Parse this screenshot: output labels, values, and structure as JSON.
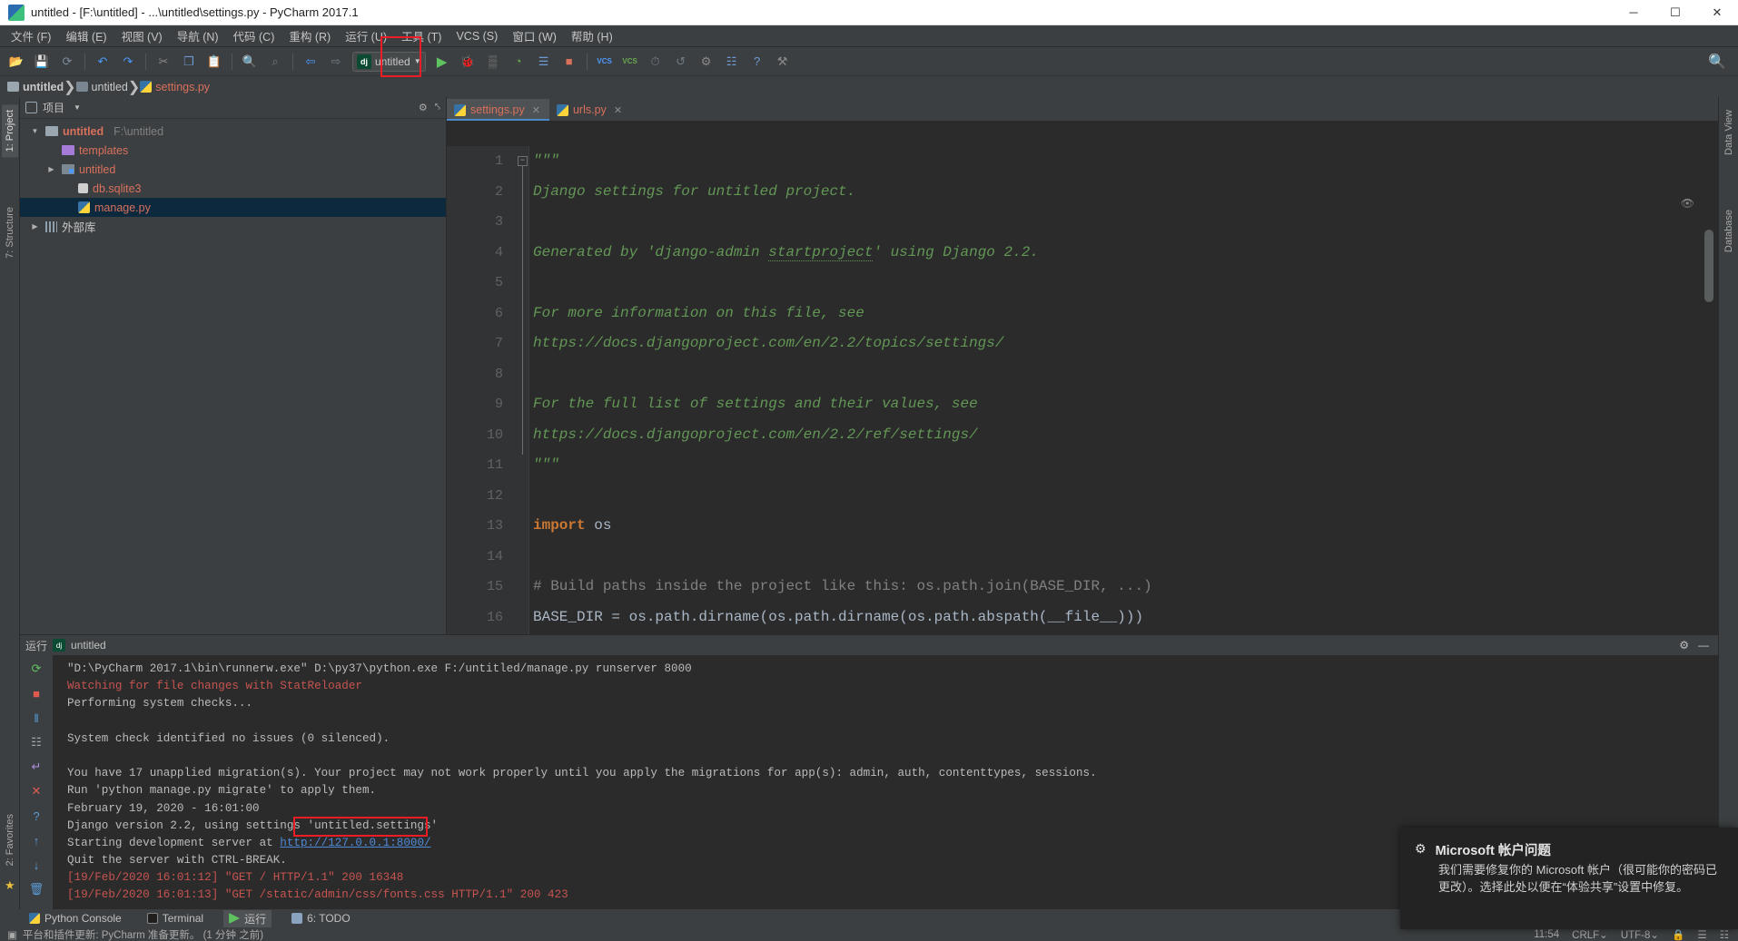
{
  "window": {
    "title": "untitled - [F:\\untitled] - ...\\untitled\\settings.py - PyCharm 2017.1",
    "app_icon": "pycharm-icon",
    "minimize": "─",
    "maximize": "☐",
    "close": "✕"
  },
  "menubar": {
    "items": [
      {
        "label": "文件 (F)"
      },
      {
        "label": "编辑 (E)"
      },
      {
        "label": "视图 (V)"
      },
      {
        "label": "导航 (N)"
      },
      {
        "label": "代码 (C)"
      },
      {
        "label": "重构 (R)"
      },
      {
        "label": "运行 (U)"
      },
      {
        "label": "工具 (T)"
      },
      {
        "label": "VCS (S)"
      },
      {
        "label": "窗口 (W)"
      },
      {
        "label": "帮助 (H)"
      }
    ]
  },
  "toolbar": {
    "buttons": [
      {
        "name": "open-folder-icon",
        "glyph": "📂",
        "color": "#d9a441"
      },
      {
        "name": "save-all-icon",
        "glyph": "💾",
        "color": "#9aa7b0"
      },
      {
        "name": "sync-icon",
        "glyph": "⟳",
        "color": "#7b8b99"
      },
      {
        "name": "undo-icon",
        "glyph": "↶",
        "color": "#4c9aff"
      },
      {
        "name": "redo-icon",
        "glyph": "↷",
        "color": "#4c9aff"
      },
      {
        "name": "cut-icon",
        "glyph": "✂",
        "color": "#8c8c8c"
      },
      {
        "name": "copy-icon",
        "glyph": "❐",
        "color": "#6e9ad4"
      },
      {
        "name": "paste-icon",
        "glyph": "📋",
        "color": "#7b8b99"
      },
      {
        "name": "find-icon",
        "glyph": "🔍",
        "color": "#8ab0d8"
      },
      {
        "name": "replace-icon",
        "glyph": "⌕",
        "color": "#6f7c86"
      },
      {
        "name": "back-icon",
        "glyph": "⇦",
        "color": "#4c9aff"
      },
      {
        "name": "forward-icon",
        "glyph": "⇨",
        "color": "#6f7c86"
      }
    ],
    "run_config": {
      "badge": "dj",
      "name": "untitled",
      "caret": "▼"
    },
    "run_button": {
      "name": "run-button",
      "glyph": "▶",
      "color": "#5ec25e"
    },
    "debug_button": {
      "name": "debug-button",
      "glyph": "🐞",
      "color": "#5ec25e"
    },
    "right_buttons": [
      {
        "name": "coverage-icon",
        "glyph": "▒",
        "color": "#8a8a8a"
      },
      {
        "name": "profile-icon",
        "glyph": "◔",
        "color": "#6aa84f"
      },
      {
        "name": "attach-icon",
        "glyph": "☰",
        "color": "#6e9ad4"
      },
      {
        "name": "stop-icon",
        "glyph": "■",
        "color": "#d9705c"
      },
      {
        "name": "vcs-update-icon",
        "glyph": "VCS",
        "color": "#4c9aff"
      },
      {
        "name": "vcs-commit-icon",
        "glyph": "VCS",
        "color": "#6aa84f"
      },
      {
        "name": "history-icon",
        "glyph": "⏱",
        "color": "#6f7c86"
      },
      {
        "name": "revert-icon",
        "glyph": "↺",
        "color": "#6f7c86"
      },
      {
        "name": "settings-icon",
        "glyph": "⚙",
        "color": "#8a8a8a"
      },
      {
        "name": "structure-icon",
        "glyph": "☷",
        "color": "#6e9ad4"
      },
      {
        "name": "help-icon",
        "glyph": "?",
        "color": "#6e9ad4"
      },
      {
        "name": "external-tool-icon",
        "glyph": "⚒",
        "color": "#8a8a8a"
      }
    ],
    "search_icon": "🔍"
  },
  "breadcrumb": {
    "items": [
      {
        "label": "untitled",
        "icon": "folder-icon",
        "bold": true
      },
      {
        "label": "untitled",
        "icon": "source-folder-icon",
        "bold": false
      },
      {
        "label": "settings.py",
        "icon": "python-file-icon",
        "bold": false
      }
    ],
    "separator": "❯"
  },
  "left_tool_strip": {
    "project_tab": "1: Project",
    "structure_tab": "7: Structure",
    "favorites_tab": "2: Favorites",
    "star_icon": "★"
  },
  "right_tool_strip": {
    "data_view_tab": "Data View",
    "database_tab": "Database"
  },
  "project_panel": {
    "title": "项目",
    "caret": "▼",
    "settings_icon": "⚙",
    "collapse_icon": "⤣",
    "tree": [
      {
        "indent": 0,
        "twisty": "▼",
        "icon": "folder-icon",
        "label": "untitled",
        "path": "F:\\untitled",
        "bold": true,
        "selected": false
      },
      {
        "indent": 1,
        "twisty": "",
        "icon": "templates-folder-icon",
        "label": "templates",
        "path": "",
        "bold": false,
        "selected": false
      },
      {
        "indent": 1,
        "twisty": "▶",
        "icon": "source-folder-icon",
        "label": "untitled",
        "path": "",
        "bold": false,
        "selected": false
      },
      {
        "indent": 2,
        "twisty": "",
        "icon": "sqlite-file-icon",
        "label": "db.sqlite3",
        "path": "",
        "bold": false,
        "selected": false
      },
      {
        "indent": 2,
        "twisty": "",
        "icon": "python-file-icon",
        "label": "manage.py",
        "path": "",
        "bold": false,
        "selected": true
      },
      {
        "indent": 0,
        "twisty": "▶",
        "icon": "external-libraries-icon",
        "label": "外部库",
        "path": "",
        "bold": false,
        "selected": false
      }
    ]
  },
  "editor": {
    "tabs": [
      {
        "label": "settings.py",
        "active": true,
        "close": "✕"
      },
      {
        "label": "urls.py",
        "active": false,
        "close": "✕"
      }
    ],
    "eye_icon": "👁",
    "lines": [
      {
        "n": "1",
        "text": "\"\"\"",
        "style": "doc"
      },
      {
        "n": "2",
        "text": "Django settings for untitled project.",
        "style": "doc"
      },
      {
        "n": "3",
        "text": "",
        "style": "doc"
      },
      {
        "n": "4",
        "text": "Generated by 'django-admin startproject' using Django 2.2.",
        "style": "doc-underline"
      },
      {
        "n": "5",
        "text": "",
        "style": "doc"
      },
      {
        "n": "6",
        "text": "For more information on this file, see",
        "style": "doc"
      },
      {
        "n": "7",
        "text": "https://docs.djangoproject.com/en/2.2/topics/settings/",
        "style": "doc"
      },
      {
        "n": "8",
        "text": "",
        "style": "doc"
      },
      {
        "n": "9",
        "text": "For the full list of settings and their values, see",
        "style": "doc"
      },
      {
        "n": "10",
        "text": "https://docs.djangoproject.com/en/2.2/ref/settings/",
        "style": "doc"
      },
      {
        "n": "11",
        "text": "\"\"\"",
        "style": "doc"
      },
      {
        "n": "12",
        "text": "",
        "style": "plain"
      },
      {
        "n": "13",
        "text": "import os",
        "style": "import"
      },
      {
        "n": "14",
        "text": "",
        "style": "plain"
      },
      {
        "n": "15",
        "text": "# Build paths inside the project like this: os.path.join(BASE_DIR, ...)",
        "style": "comment"
      },
      {
        "n": "16",
        "text": "BASE_DIR = os.path.dirname(os.path.dirname(os.path.abspath(__file__)))",
        "style": "plain"
      }
    ]
  },
  "run_panel": {
    "header_label": "运行",
    "config_badge": "dj",
    "config_name": "untitled",
    "settings_icon": "⚙",
    "minimize_icon": "—",
    "sidebar_icons": [
      {
        "name": "rerun-icon",
        "glyph": "⟳",
        "color": "#5ec25e"
      },
      {
        "name": "stop-icon",
        "glyph": "■",
        "color": "#e05a4f"
      },
      {
        "name": "pause-icon",
        "glyph": "‖",
        "color": "#5b9bd5"
      },
      {
        "name": "print-icon",
        "glyph": "☷",
        "color": "#9aa7b0"
      },
      {
        "name": "soft-wrap-icon",
        "glyph": "↵",
        "color": "#a98bd8"
      },
      {
        "name": "clear-icon",
        "glyph": "✕",
        "color": "#e05a4f"
      },
      {
        "name": "help-icon",
        "glyph": "?",
        "color": "#5b9bd5"
      },
      {
        "name": "scroll-up-icon",
        "glyph": "↑",
        "color": "#5b9bd5"
      },
      {
        "name": "scroll-down-icon",
        "glyph": "↓",
        "color": "#5b9bd5"
      },
      {
        "name": "trash-icon",
        "glyph": "🗑",
        "color": "#5b9bd5"
      }
    ],
    "console_lines": [
      {
        "text": "\"D:\\PyCharm 2017.1\\bin\\runnerw.exe\" D:\\py37\\python.exe F:/untitled/manage.py runserver 8000",
        "style": "normal"
      },
      {
        "text": "Watching for file changes with StatReloader",
        "style": "error"
      },
      {
        "text": "Performing system checks...",
        "style": "normal"
      },
      {
        "text": "",
        "style": "normal"
      },
      {
        "text": "System check identified no issues (0 silenced).",
        "style": "normal"
      },
      {
        "text": "",
        "style": "normal"
      },
      {
        "text": "You have 17 unapplied migration(s). Your project may not work properly until you apply the migrations for app(s): admin, auth, contenttypes, sessions.",
        "style": "normal"
      },
      {
        "text": "Run 'python manage.py migrate' to apply them.",
        "style": "normal"
      },
      {
        "text": "February 19, 2020 - 16:01:00",
        "style": "normal"
      },
      {
        "text": "Django version 2.2, using settings 'untitled.settings'",
        "style": "normal"
      },
      {
        "text": "Starting development server at ",
        "style": "link-prefix",
        "link": "http://127.0.0.1:8000/"
      },
      {
        "text": "Quit the server with CTRL-BREAK.",
        "style": "normal"
      },
      {
        "text": "[19/Feb/2020 16:01:12] \"GET / HTTP/1.1\" 200 16348",
        "style": "error"
      },
      {
        "text": "[19/Feb/2020 16:01:13] \"GET /static/admin/css/fonts.css HTTP/1.1\" 200 423",
        "style": "error"
      }
    ]
  },
  "bottom_tabs": [
    {
      "label": "Python Console",
      "icon": "python-icon",
      "active": false
    },
    {
      "label": "Terminal",
      "icon": "terminal-icon",
      "active": false
    },
    {
      "label": "运行",
      "icon": "run-icon",
      "active": true
    },
    {
      "label": "6: TODO",
      "icon": "todo-icon",
      "active": false
    }
  ],
  "statusbar": {
    "icon": "▣",
    "message": "平台和插件更新: PyCharm 准备更新。 (1 分钟 之前)",
    "time": "11:54",
    "line_separator": "CRLF⌄",
    "encoding": "UTF-8⌄",
    "lock_icon": "🔒",
    "layout_icon": "☰",
    "ide_icon": "☷"
  },
  "toast": {
    "gear_icon": "⚙",
    "title": "Microsoft 帐户问题",
    "body": "我们需要修复你的 Microsoft 帐户（很可能你的密码已更改）。选择此处以便在“体验共享”设置中修复。"
  },
  "annotations": {
    "run_button_highlight_color": "#ee1c25",
    "url_highlight_color": "#ee1c25"
  }
}
